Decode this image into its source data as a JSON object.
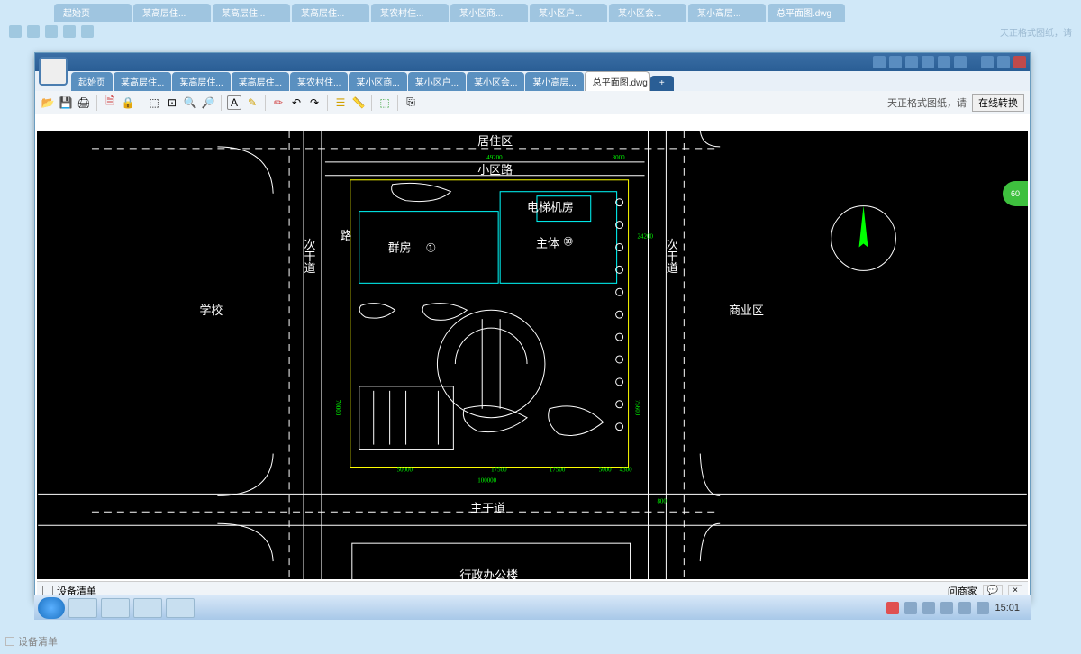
{
  "outer_tabs": [
    "起始页",
    "某高层住...",
    "某高层住...",
    "某高层住...",
    "某农村住...",
    "某小区商...",
    "某小区户...",
    "某小区会...",
    "某小高层...",
    "总平面图.dwg"
  ],
  "cad": {
    "tabs": [
      {
        "label": "起始页"
      },
      {
        "label": "某高层住..."
      },
      {
        "label": "某高层住..."
      },
      {
        "label": "某高层住..."
      },
      {
        "label": "某农村住..."
      },
      {
        "label": "某小区商..."
      },
      {
        "label": "某小区户..."
      },
      {
        "label": "某小区会..."
      },
      {
        "label": "某小高层..."
      },
      {
        "label": "总平面图.dwg",
        "active": true
      }
    ],
    "toolbar_right_text": "天正格式图纸，请",
    "convert_button": "在线转换",
    "badge": "60"
  },
  "drawing_labels": {
    "residential_zone": "居住区",
    "community_road": "小区路",
    "elevator_room": "电梯机房",
    "podium": "群房",
    "main_body": "主体",
    "school": "学校",
    "commercial_zone": "商业区",
    "secondary_road_left": "次干道",
    "secondary_road_right": "次干道",
    "road_label": "路",
    "main_road": "主干道",
    "admin_building": "行政办公楼",
    "marker_1": "①",
    "marker_2": "⑩",
    "dims": {
      "d1": "49200",
      "d2": "8000",
      "d3": "24200",
      "d4": "70000",
      "d5": "75600",
      "d6": "100000",
      "d7": "50000",
      "d8": "17500",
      "d9": "17500",
      "d10": "5000",
      "d11": "4300",
      "d12": "800"
    }
  },
  "statusbar": {
    "equipment_list": "设备清单",
    "inquiry": "问商家"
  },
  "taskbar": {
    "time": "15:01"
  },
  "faded_status": "设备清单",
  "outer_right_hint": "天正格式图纸，请"
}
